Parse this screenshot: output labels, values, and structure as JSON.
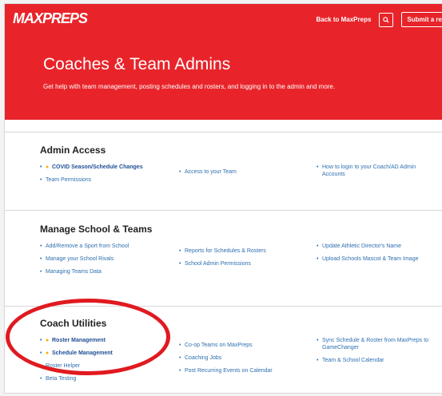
{
  "header": {
    "logo": "MAXPREPS",
    "back_link": "Back to MaxPreps",
    "search_icon": "search-icon",
    "submit_label": "Submit a re"
  },
  "hero": {
    "title": "Coaches & Team Admins",
    "subtitle": "Get help with team management, posting schedules and rosters, and logging in to the admin and more."
  },
  "sections": {
    "admin_access": {
      "title": "Admin Access",
      "col1": [
        "COVID Season/Schedule Changes",
        "Team Permissions"
      ],
      "col2": [
        "Access to your Team"
      ],
      "col3": [
        "How to login to your Coach/AD Admin Accounts"
      ]
    },
    "manage": {
      "title": "Manage School & Teams",
      "col1": [
        "Add/Remove a Sport from School",
        "Manage your School Rivals",
        "Managing Teams Data"
      ],
      "col2": [
        "Reports for Schedules & Rosters",
        "School Admin Permissions"
      ],
      "col3": [
        "Update Athletic Director's Name",
        "Upload Schools Mascot & Team Image"
      ]
    },
    "coach_utilities": {
      "title": "Coach Utilities",
      "col1": [
        "Roster Management",
        "Schedule Management",
        "Roster Helper",
        "Beta Testing"
      ],
      "col2": [
        "Co-op Teams on MaxPreps",
        "Coaching Jobs",
        "Post Recurring Events on Calendar"
      ],
      "col3": [
        "Sync Schedule & Roster from MaxPreps to GameChanger",
        "Team & School Calendar"
      ]
    }
  },
  "colors": {
    "brand_red": "#e8242a",
    "link_blue": "#2d6fb0",
    "star_yellow": "#f2b600",
    "annotation_red": "#e01a20"
  }
}
